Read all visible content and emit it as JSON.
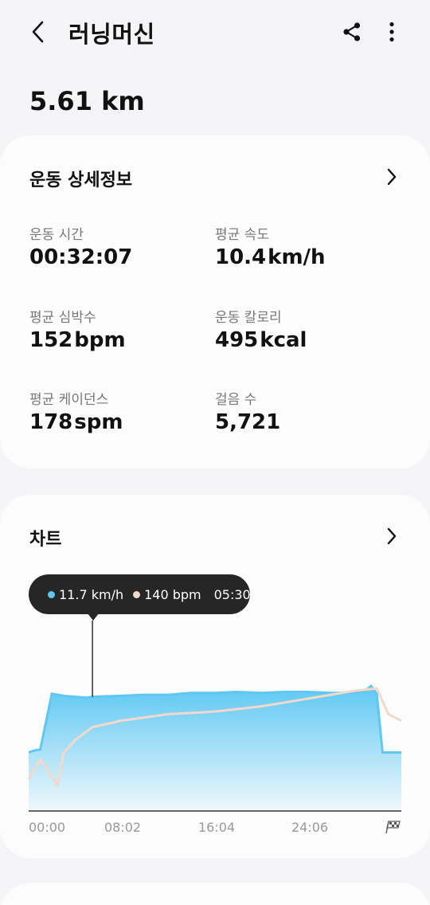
{
  "header": {
    "title": "러닝머신",
    "back_icon": "chevron-left-icon",
    "share_icon": "share-icon",
    "more_icon": "more-vertical-icon"
  },
  "summary": {
    "distance": "5.61 km"
  },
  "details": {
    "title": "운동 상세정보",
    "stats": [
      {
        "label": "운동 시간",
        "value": "00:32:07",
        "unit": ""
      },
      {
        "label": "평균 속도",
        "value": "10.4",
        "unit": "km/h"
      },
      {
        "label": "평균 심박수",
        "value": "152",
        "unit": "bpm"
      },
      {
        "label": "운동 칼로리",
        "value": "495",
        "unit": "kcal"
      },
      {
        "label": "평균 케이던스",
        "value": "178",
        "unit": "spm"
      },
      {
        "label": "걸음 수",
        "value": "5,721",
        "unit": ""
      }
    ]
  },
  "chart": {
    "title": "차트",
    "tooltip": {
      "speed": "11.7 km/h",
      "heart_rate": "140 bpm",
      "time": "05:30"
    },
    "x_ticks": [
      "00:00",
      "08:02",
      "16:04",
      "24:06"
    ],
    "finish_icon": "checkered-flag-icon",
    "colors": {
      "speed": "#5ec8f3",
      "heart_rate": "#f2d9c9",
      "tooltip_bg": "#262626"
    }
  },
  "chart_data": {
    "type": "area",
    "series": [
      {
        "name": "",
        "unit": "km/h",
        "x": [
          "00:00",
          "00:30",
          "01:00",
          "02:00",
          "03:00",
          "04:00",
          "05:00",
          "05:30",
          "08:00",
          "10:00",
          "12:00",
          "14:00",
          "16:00",
          "18:00",
          "20:00",
          "22:00",
          "24:00",
          "26:00",
          "28:00",
          "29:00",
          "29:30",
          "30:00",
          "30:30",
          "31:00",
          "32:07"
        ],
        "values": [
          6.0,
          6.2,
          6.3,
          12.0,
          11.8,
          11.7,
          11.6,
          11.7,
          11.8,
          11.9,
          11.9,
          12.1,
          12.1,
          12.2,
          12.1,
          12.2,
          12.2,
          12.1,
          12.1,
          12.3,
          12.8,
          12.0,
          6.0,
          6.0,
          6.0
        ]
      },
      {
        "name": "",
        "unit": "bpm",
        "x": [
          "00:00",
          "01:00",
          "02:30",
          "03:00",
          "04:00",
          "05:30",
          "08:00",
          "12:00",
          "16:00",
          "20:00",
          "24:00",
          "28:00",
          "30:00",
          "31:00",
          "32:07"
        ],
        "values": [
          100,
          115,
          95,
          120,
          130,
          140,
          145,
          150,
          152,
          156,
          162,
          168,
          170,
          150,
          145
        ]
      }
    ]
  }
}
